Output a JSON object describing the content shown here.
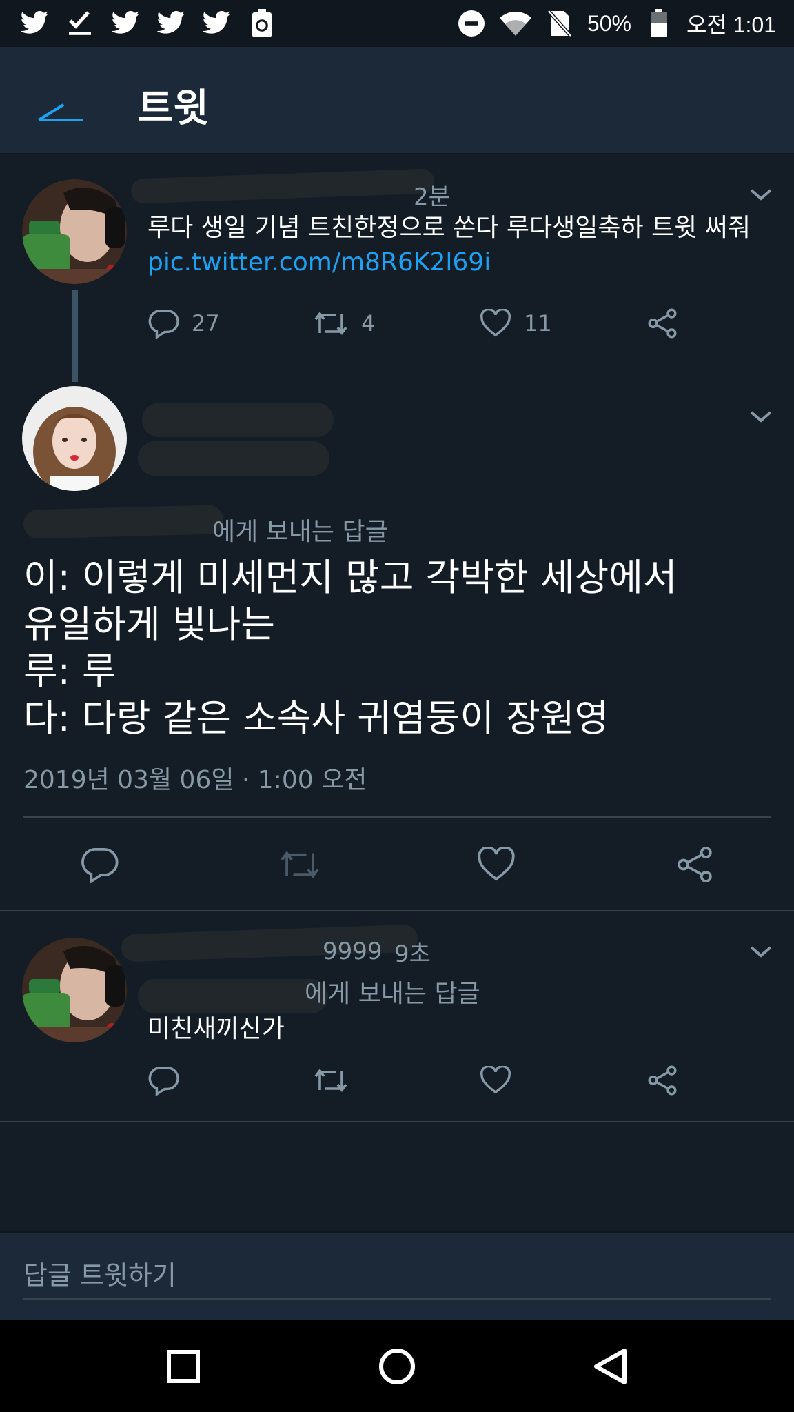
{
  "status_bar": {
    "battery_percent": "50%",
    "time": "오전 1:01",
    "left_icons": [
      "twitter-icon",
      "check-icon",
      "twitter-icon",
      "twitter-icon",
      "twitter-icon",
      "recycle-battery-icon"
    ],
    "right_icons": [
      "do-not-disturb-icon",
      "wifi-icon",
      "no-sim-icon",
      "battery-icon"
    ]
  },
  "header": {
    "title": "트윗"
  },
  "tweet1": {
    "time_partial": "2분",
    "text": "루다 생일 기념 트친한정으로 쏜다 루다생일축하 트윗 써줘",
    "link": "pic.twitter.com/m8R6K2l69i",
    "replies": "27",
    "retweets": "4",
    "likes": "11"
  },
  "main_tweet": {
    "reply_to_partial": "에게 보내는 답글",
    "lines": [
      "이: 이렇게 미세먼지 많고 각박한 세상에서",
      "유일하게 빛나는",
      "루: 루",
      "다: 다랑 같은 소속사 귀염둥이 장원영"
    ],
    "date": "2019년 03월 06일 · 1:00 오전"
  },
  "tweet3": {
    "handle_partial": "9999",
    "time_partial": "9초",
    "reply_to_partial": "에게 보내는 답글",
    "text": "미친새끼신가"
  },
  "reply_bar": {
    "placeholder": "답글 트윗하기"
  },
  "colors": {
    "background": "#141d26",
    "header": "#1c2938",
    "accent": "#1da1f2",
    "muted": "#8899a6"
  }
}
